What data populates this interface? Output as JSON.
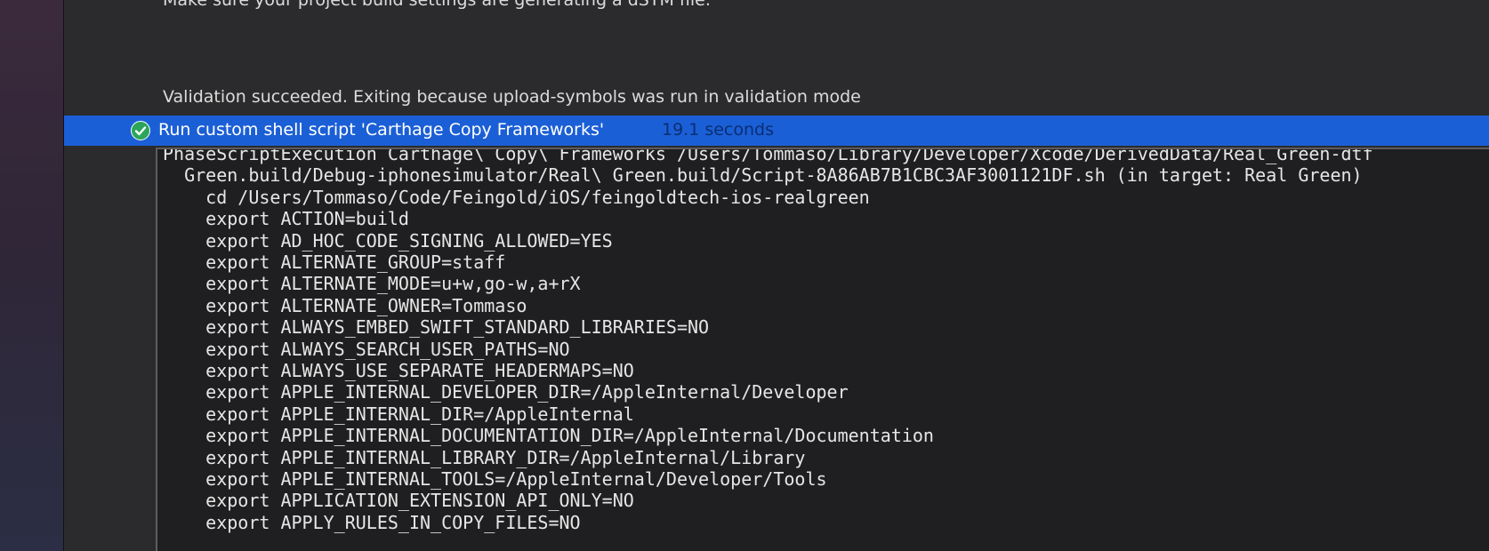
{
  "log": {
    "prev_line_cut": "Make sure your project build settings are generating a dSYM file.",
    "validation": "Validation succeeded. Exiting because upload-symbols was run in validation mode"
  },
  "step": {
    "title": "Run custom shell script 'Carthage Copy Frameworks'",
    "duration": "19.1 seconds",
    "status": "success",
    "status_icon": "checkmark-circle-icon",
    "colors": {
      "selection": "#1b5fd6",
      "success": "#2ca55a"
    }
  },
  "console": {
    "lines": [
      "PhaseScriptExecution Carthage\\ Copy\\ Frameworks /Users/Tommaso/Library/Developer/Xcode/DerivedData/Real_Green-dtf",
      "  Green.build/Debug-iphonesimulator/Real\\ Green.build/Script-8A86AB7B1CBC3AF3001121DF.sh (in target: Real Green)",
      "    cd /Users/Tommaso/Code/Feingold/iOS/feingoldtech-ios-realgreen",
      "    export ACTION=build",
      "    export AD_HOC_CODE_SIGNING_ALLOWED=YES",
      "    export ALTERNATE_GROUP=staff",
      "    export ALTERNATE_MODE=u+w,go-w,a+rX",
      "    export ALTERNATE_OWNER=Tommaso",
      "    export ALWAYS_EMBED_SWIFT_STANDARD_LIBRARIES=NO",
      "    export ALWAYS_SEARCH_USER_PATHS=NO",
      "    export ALWAYS_USE_SEPARATE_HEADERMAPS=NO",
      "    export APPLE_INTERNAL_DEVELOPER_DIR=/AppleInternal/Developer",
      "    export APPLE_INTERNAL_DIR=/AppleInternal",
      "    export APPLE_INTERNAL_DOCUMENTATION_DIR=/AppleInternal/Documentation",
      "    export APPLE_INTERNAL_LIBRARY_DIR=/AppleInternal/Library",
      "    export APPLE_INTERNAL_TOOLS=/AppleInternal/Developer/Tools",
      "    export APPLICATION_EXTENSION_API_ONLY=NO",
      "    export APPLY_RULES_IN_COPY_FILES=NO"
    ]
  }
}
